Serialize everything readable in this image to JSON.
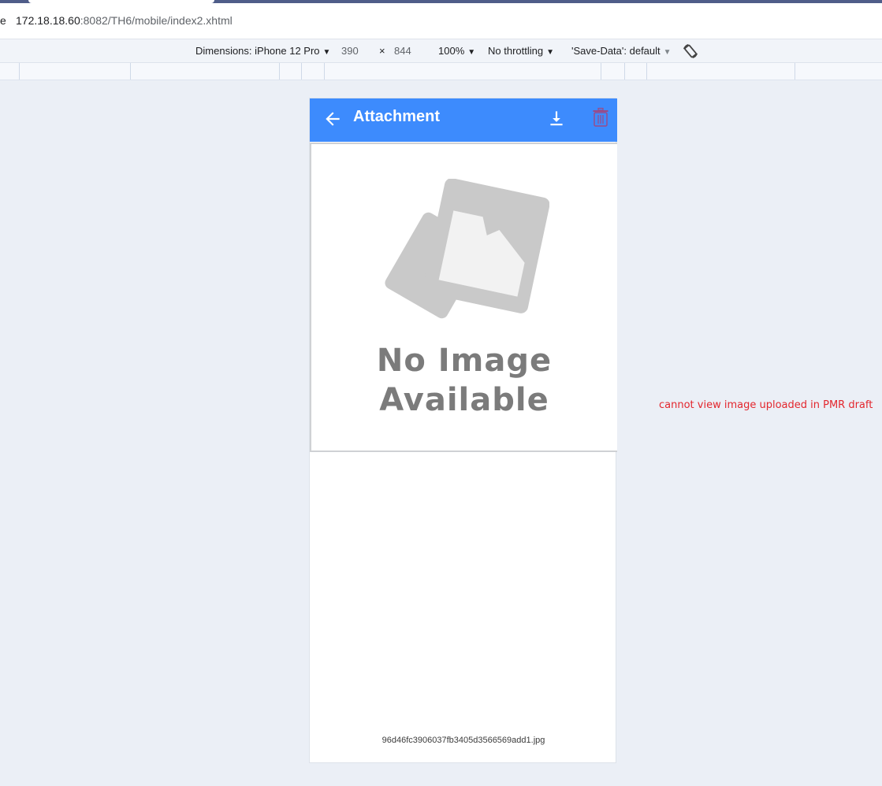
{
  "browser": {
    "lead_char": "e",
    "url_host": "172.18.18.60",
    "url_rest": ":8082/TH6/mobile/index2.xhtml"
  },
  "device_toolbar": {
    "dimensions_label": "Dimensions: iPhone 12 Pro",
    "width": "390",
    "times": "×",
    "height": "844",
    "zoom": "100%",
    "throttling": "No throttling",
    "save_data": "'Save-Data': default"
  },
  "app": {
    "title": "Attachment",
    "accent_color": "#3d8bfd",
    "placeholder_line1": "No Image",
    "placeholder_line2": "Available",
    "file_name": "96d46fc3906037fb3405d3566569add1.jpg",
    "icons": [
      "arrow-left-icon",
      "download-icon",
      "trash-icon"
    ]
  },
  "annotation": {
    "text": "cannot view image uploaded in PMR draft",
    "color": "#e3262d"
  }
}
